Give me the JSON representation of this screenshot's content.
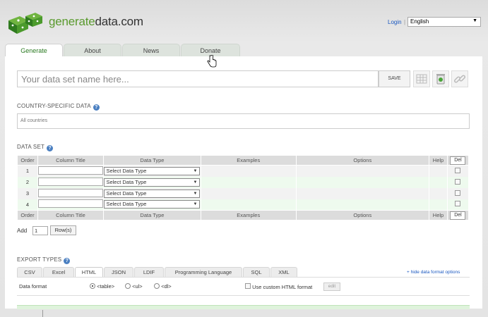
{
  "header": {
    "logo_generate": "generate",
    "logo_rest": "data.com",
    "login_label": "Login",
    "separator": "|",
    "language_selected": "English"
  },
  "tabs": [
    {
      "label": "Generate",
      "active": true
    },
    {
      "label": "About",
      "active": false
    },
    {
      "label": "News",
      "active": false
    },
    {
      "label": "Donate",
      "active": false
    }
  ],
  "dataset_name": {
    "placeholder": "Your data set name here...",
    "save_label": "SAVE"
  },
  "country": {
    "title": "COUNTRY-SPECIFIC DATA",
    "value": "All countries"
  },
  "dataset": {
    "title": "DATA SET",
    "headers": {
      "order": "Order",
      "column_title": "Column Title",
      "data_type": "Data Type",
      "examples": "Examples",
      "options": "Options",
      "help": "Help",
      "del": "Del"
    },
    "rows": [
      {
        "order": "1",
        "data_type": "Select Data Type"
      },
      {
        "order": "2",
        "data_type": "Select Data Type"
      },
      {
        "order": "3",
        "data_type": "Select Data Type"
      },
      {
        "order": "4",
        "data_type": "Select Data Type"
      }
    ],
    "add_label": "Add",
    "add_count": "1",
    "rows_button": "Row(s)"
  },
  "export": {
    "title": "EXPORT TYPES",
    "tabs": [
      {
        "label": "CSV"
      },
      {
        "label": "Excel"
      },
      {
        "label": "HTML"
      },
      {
        "label": "JSON"
      },
      {
        "label": "LDIF"
      },
      {
        "label": "Programming Language"
      },
      {
        "label": "SQL"
      },
      {
        "label": "XML"
      }
    ],
    "active_tab": "HTML",
    "hide_link": "+ hide data format options",
    "format_label": "Data format",
    "format_options": [
      "<table>",
      "<ul>",
      "<dl>"
    ],
    "custom_label": "Use custom HTML format",
    "edit_label": "edit"
  },
  "colors": {
    "brand_green": "#5a9a2e",
    "link_blue": "#1a58c0",
    "active_tab_text": "#2b7a22"
  }
}
